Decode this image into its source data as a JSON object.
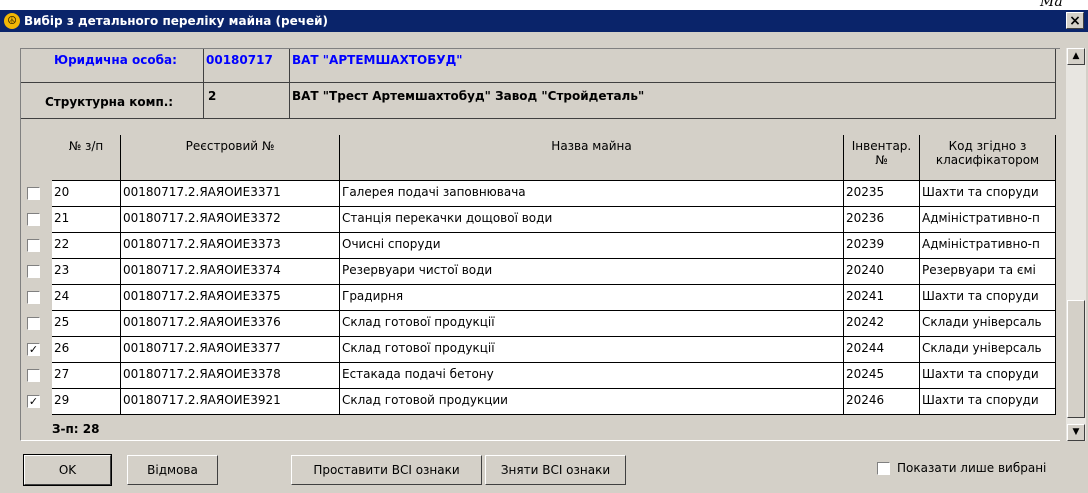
{
  "window": {
    "title": "Вибір з детального переліку майна (речей)",
    "corner_text": "Ма",
    "close_glyph": "×"
  },
  "entity": {
    "legal_label": "Юридична особа:",
    "legal_code": "00180717",
    "legal_name": "ВАТ \"АРТЕМШАХТОБУД\"",
    "struct_label": "Структурна комп.:",
    "struct_code": "2",
    "struct_name": "ВАТ \"Трест Артемшахтобуд\" Завод \"Стройдеталь\""
  },
  "table": {
    "columns": [
      "№ з/п",
      "Реєстровий №",
      "Назва майна",
      "Інвентар. №",
      "Код згідно з класифікатором"
    ],
    "rows": [
      {
        "checked": false,
        "num": "20",
        "reg": "00180717.2.ЯАЯОИЕ3371",
        "name": "Галерея подачі заповнювача",
        "inv": "20235",
        "code": "Шахти та споруди"
      },
      {
        "checked": false,
        "num": "21",
        "reg": "00180717.2.ЯАЯОИЕ3372",
        "name": "Станція перекачки дощової води",
        "inv": "20236",
        "code": "Адміністративно-п"
      },
      {
        "checked": false,
        "num": "22",
        "reg": "00180717.2.ЯАЯОИЕ3373",
        "name": "Очисні споруди",
        "inv": "20239",
        "code": "Адміністративно-п"
      },
      {
        "checked": false,
        "num": "23",
        "reg": "00180717.2.ЯАЯОИЕ3374",
        "name": "Резервуари чистої води",
        "inv": "20240",
        "code": "Резервуари та ємі"
      },
      {
        "checked": false,
        "num": "24",
        "reg": "00180717.2.ЯАЯОИЕ3375",
        "name": "Градирня",
        "inv": "20241",
        "code": "Шахти та споруди"
      },
      {
        "checked": false,
        "num": "25",
        "reg": "00180717.2.ЯАЯОИЕ3376",
        "name": "Склад готової продукції",
        "inv": "20242",
        "code": "Склади універсаль"
      },
      {
        "checked": true,
        "num": "26",
        "reg": "00180717.2.ЯАЯОИЕ3377",
        "name": "Склад готової продукції",
        "inv": "20244",
        "code": "Склади універсаль"
      },
      {
        "checked": false,
        "num": "27",
        "reg": "00180717.2.ЯАЯОИЕ3378",
        "name": "Естакада подачі бетону",
        "inv": "20245",
        "code": "Шахти та споруди"
      },
      {
        "checked": true,
        "num": "29",
        "reg": "00180717.2.ЯАЯОИЕ3921",
        "name": "Склад готовой продукции",
        "inv": "20246",
        "code": "Шахти та споруди"
      }
    ],
    "checkmark": "✓",
    "count_text": "З-п: 28"
  },
  "scroll": {
    "up_glyph": "▲",
    "down_glyph": "▼"
  },
  "buttons": {
    "ok": "OK",
    "cancel": "Відмова",
    "select_all": "Проставити ВСІ ознаки",
    "clear_all": "Зняти ВСІ ознаки",
    "show_selected": "Показати лише вибрані"
  }
}
